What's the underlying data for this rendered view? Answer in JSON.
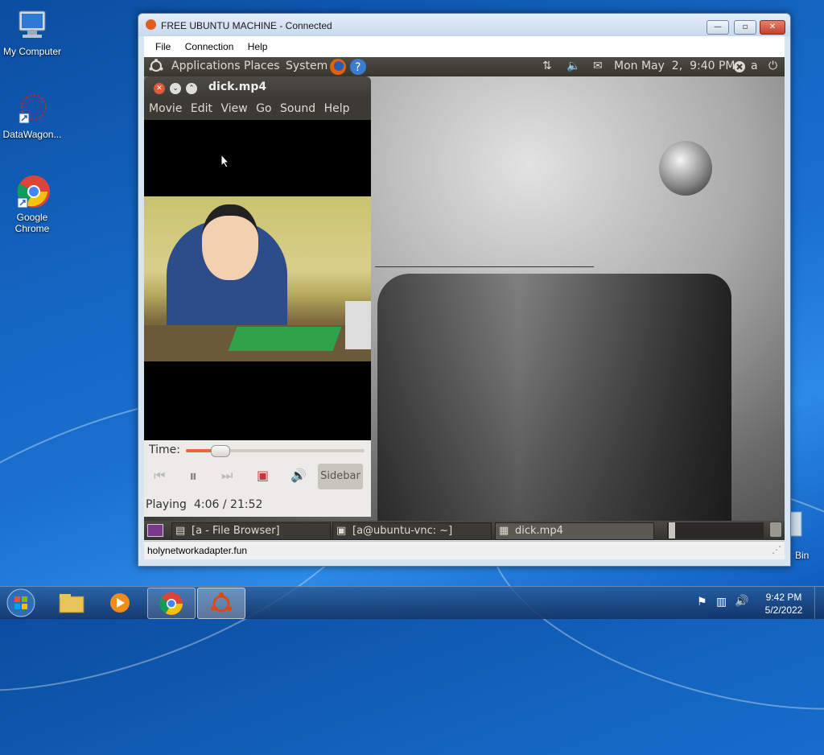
{
  "desktop": {
    "icons": [
      {
        "label": "My Computer"
      },
      {
        "label": "DataWagon..."
      },
      {
        "label": "Google Chrome"
      }
    ],
    "recycle_bin_label": "Bin"
  },
  "vnc_window": {
    "title": "FREE UBUNTU MACHINE - Connected",
    "menu": [
      "File",
      "Connection",
      "Help"
    ],
    "status": "holynetworkadapter.fun",
    "controls": {
      "minimize": "—",
      "maximize": "▫",
      "close": "✕"
    }
  },
  "ubuntu": {
    "top_panel": {
      "menus": [
        "Applications",
        "Places",
        "System"
      ],
      "clock": "Mon May  2,  9:40 PM",
      "user": "a"
    },
    "totem": {
      "title": "dick.mp4",
      "menu": [
        "Movie",
        "Edit",
        "View",
        "Go",
        "Sound",
        "Help"
      ],
      "time_label": "Time:",
      "seek_fraction": 0.19,
      "sidebar_label": "Sidebar",
      "status": "Playing",
      "position": "4:06 / 21:52"
    },
    "taskbar": [
      {
        "label": "[a - File Browser]"
      },
      {
        "label": "[a@ubuntu-vnc: ~]"
      },
      {
        "label": "dick.mp4"
      }
    ]
  },
  "win_taskbar": {
    "time": "9:42 PM",
    "date": "5/2/2022"
  },
  "colors": {
    "win7_blue": "#1466c2",
    "gnome_panel": "#3b3a34",
    "seek_orange": "#e8673a",
    "ubuntu_orange": "#dd4814"
  }
}
